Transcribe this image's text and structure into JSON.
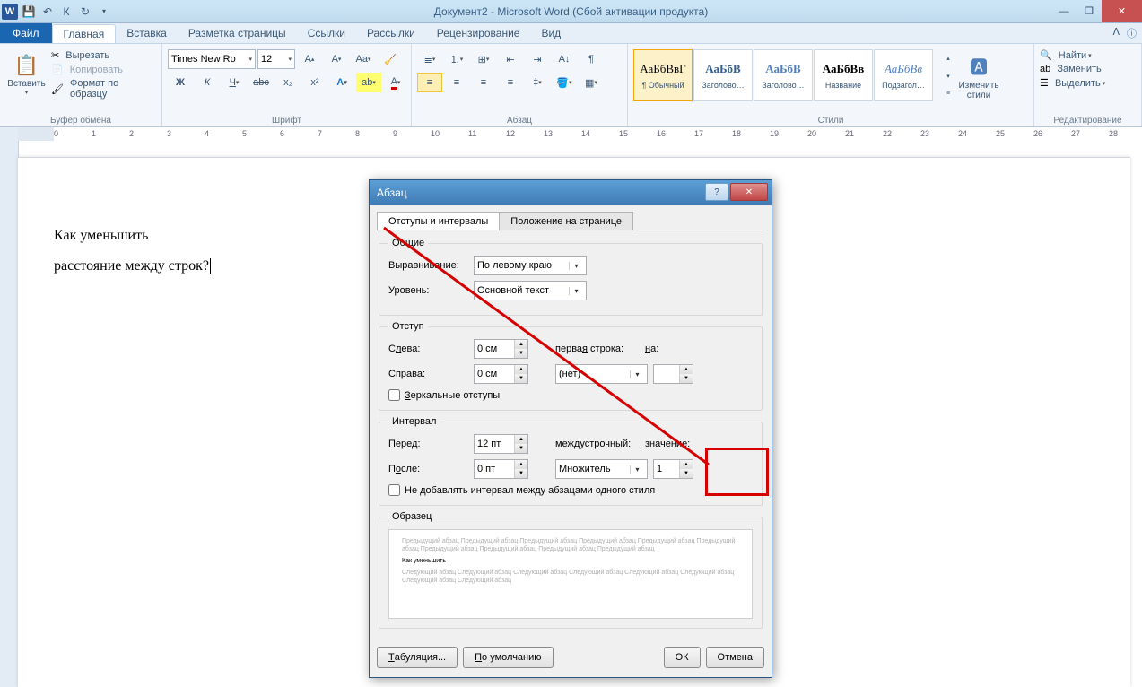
{
  "title": "Документ2 - Microsoft Word (Сбой активации продукта)",
  "tabs": {
    "file": "Файл",
    "home": "Главная",
    "insert": "Вставка",
    "layout": "Разметка страницы",
    "refs": "Ссылки",
    "mail": "Рассылки",
    "review": "Рецензирование",
    "view": "Вид"
  },
  "clipboard": {
    "paste": "Вставить",
    "cut": "Вырезать",
    "copy": "Копировать",
    "formatp": "Формат по образцу",
    "group": "Буфер обмена"
  },
  "font": {
    "name": "Times New Ro",
    "size": "12",
    "group": "Шрифт"
  },
  "para": {
    "group": "Абзац"
  },
  "styles": {
    "group": "Стили",
    "s1": "¶ Обычный",
    "s2": "Заголово…",
    "s3": "Заголово…",
    "s4": "Название",
    "s5": "Подзагол…",
    "change": "Изменить стили",
    "sample": "АаБбВвГ",
    "sample2": "АаБбВ",
    "sample3": "АаБбВв",
    "sampleit": "АаБбВв"
  },
  "editing": {
    "group": "Редактирование",
    "find": "Найти",
    "replace": "Заменить",
    "select": "Выделить"
  },
  "doc": {
    "line1": "Как уменьшить",
    "line2": "расстояние между строк?"
  },
  "dialog": {
    "title": "Абзац",
    "tab1": "Отступы и интервалы",
    "tab2": "Положение на странице",
    "general": "Общие",
    "align": "Выравнивание:",
    "align_v": "По левому краю",
    "level": "Уровень:",
    "level_v": "Основной текст",
    "indent": "Отступ",
    "left": "Слева:",
    "left_v": "0 см",
    "right": "Справа:",
    "right_v": "0 см",
    "first": "первая строка:",
    "first_v": "(нет)",
    "on": "на:",
    "on_v": "",
    "mirror": "Зеркальные отступы",
    "spacing": "Интервал",
    "before": "Перед:",
    "before_v": "12 пт",
    "after": "После:",
    "after_v": "0 пт",
    "line": "междустрочный:",
    "line_v": "Множитель",
    "value": "значение:",
    "value_v": "1",
    "nospace": "Не добавлять интервал между абзацами одного стиля",
    "sample": "Образец",
    "prev_text": "Предыдущий абзац Предыдущий абзац Предыдущий абзац Предыдущий абзац Предыдущий абзац Предыдущий абзац Предыдущий абзац Предыдущий абзац Предыдущий абзац Предыдущий абзац",
    "prev_main": "Как уменьшить",
    "next_text": "Следующий абзац Следующий абзац Следующий абзац Следующий абзац Следующий абзац Следующий абзац Следующий абзац Следующий абзац",
    "tabs_btn": "Табуляция...",
    "default_btn": "По умолчанию",
    "ok": "ОК",
    "cancel": "Отмена"
  }
}
